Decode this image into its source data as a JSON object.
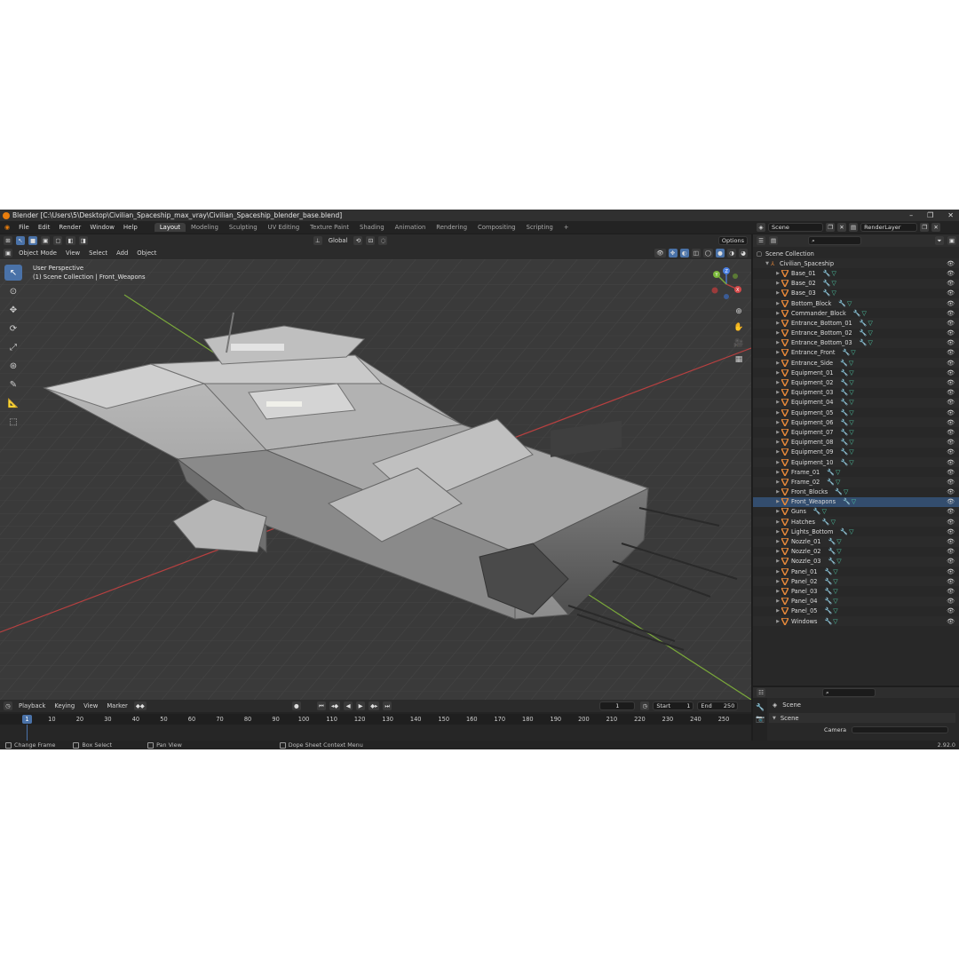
{
  "window": {
    "title": "Blender [C:\\Users\\5\\Desktop\\Civilian_Spaceship_max_vray\\Civilian_Spaceship_blender_base.blend]",
    "minimize": "–",
    "maximize": "❐",
    "close": "✕"
  },
  "menu": [
    "File",
    "Edit",
    "Render",
    "Window",
    "Help"
  ],
  "workspaces": [
    "Layout",
    "Modeling",
    "Sculpting",
    "UV Editing",
    "Texture Paint",
    "Shading",
    "Animation",
    "Rendering",
    "Compositing",
    "Scripting"
  ],
  "active_workspace": "Layout",
  "add_workspace": "+",
  "scene_field": "Scene",
  "render_layer_field": "RenderLayer",
  "viewport": {
    "transform_orientation": "Global",
    "options_label": "Options",
    "mode": "Object Mode",
    "menus": [
      "View",
      "Select",
      "Add",
      "Object"
    ],
    "perspective_label": "User Perspective",
    "collection_label": "(1) Scene Collection | Front_Weapons",
    "gizmo": {
      "x": "X",
      "y": "Y",
      "z": "Z"
    }
  },
  "outliner": {
    "root": "Scene Collection",
    "collection": "Civilian_Spaceship",
    "objects": [
      {
        "name": "Base_01",
        "active": false
      },
      {
        "name": "Base_02",
        "active": false
      },
      {
        "name": "Base_03",
        "active": false
      },
      {
        "name": "Bottom_Block",
        "active": false
      },
      {
        "name": "Commander_Block",
        "active": false
      },
      {
        "name": "Entrance_Bottom_01",
        "active": false
      },
      {
        "name": "Entrance_Bottom_02",
        "active": false
      },
      {
        "name": "Entrance_Bottom_03",
        "active": false
      },
      {
        "name": "Entrance_Front",
        "active": false
      },
      {
        "name": "Entrance_Side",
        "active": false
      },
      {
        "name": "Equipment_01",
        "active": false
      },
      {
        "name": "Equipment_02",
        "active": false
      },
      {
        "name": "Equipment_03",
        "active": false
      },
      {
        "name": "Equipment_04",
        "active": false
      },
      {
        "name": "Equipment_05",
        "active": false
      },
      {
        "name": "Equipment_06",
        "active": false
      },
      {
        "name": "Equipment_07",
        "active": false
      },
      {
        "name": "Equipment_08",
        "active": false
      },
      {
        "name": "Equipment_09",
        "active": false
      },
      {
        "name": "Equipment_10",
        "active": false
      },
      {
        "name": "Frame_01",
        "active": false
      },
      {
        "name": "Frame_02",
        "active": false
      },
      {
        "name": "Front_Blocks",
        "active": false
      },
      {
        "name": "Front_Weapons",
        "active": true
      },
      {
        "name": "Guns",
        "active": false
      },
      {
        "name": "Hatches",
        "active": false
      },
      {
        "name": "Lights_Bottom",
        "active": false
      },
      {
        "name": "Nozzle_01",
        "active": false
      },
      {
        "name": "Nozzle_02",
        "active": false
      },
      {
        "name": "Nozzle_03",
        "active": false
      },
      {
        "name": "Panel_01",
        "active": false
      },
      {
        "name": "Panel_02",
        "active": false
      },
      {
        "name": "Panel_03",
        "active": false
      },
      {
        "name": "Panel_04",
        "active": false
      },
      {
        "name": "Panel_05",
        "active": false
      },
      {
        "name": "Windows",
        "active": false
      }
    ]
  },
  "properties": {
    "scene_label": "Scene",
    "section_label": "Scene",
    "camera_label": "Camera"
  },
  "timeline": {
    "menus": [
      "Playback",
      "Keying",
      "View",
      "Marker"
    ],
    "current_frame": "1",
    "start_label": "Start",
    "start_value": "1",
    "end_label": "End",
    "end_value": "250",
    "ticks": [
      "1",
      "10",
      "20",
      "30",
      "40",
      "50",
      "60",
      "70",
      "80",
      "90",
      "100",
      "110",
      "120",
      "130",
      "140",
      "150",
      "160",
      "170",
      "180",
      "190",
      "200",
      "210",
      "220",
      "230",
      "240",
      "250"
    ]
  },
  "status": {
    "change_frame": "Change Frame",
    "box_select": "Box Select",
    "pan_view": "Pan View",
    "context_menu": "Dope Sheet Context Menu",
    "version": "2.92.0"
  },
  "colors": {
    "accent": "#4a72a8",
    "mesh_orange": "#e8893a",
    "modifier_blue": "#6e9ed8",
    "data_green": "#4ec9a6",
    "grid_line": "#464646",
    "axis_x_red": "#b84040",
    "axis_y_green": "#7aa83a"
  }
}
